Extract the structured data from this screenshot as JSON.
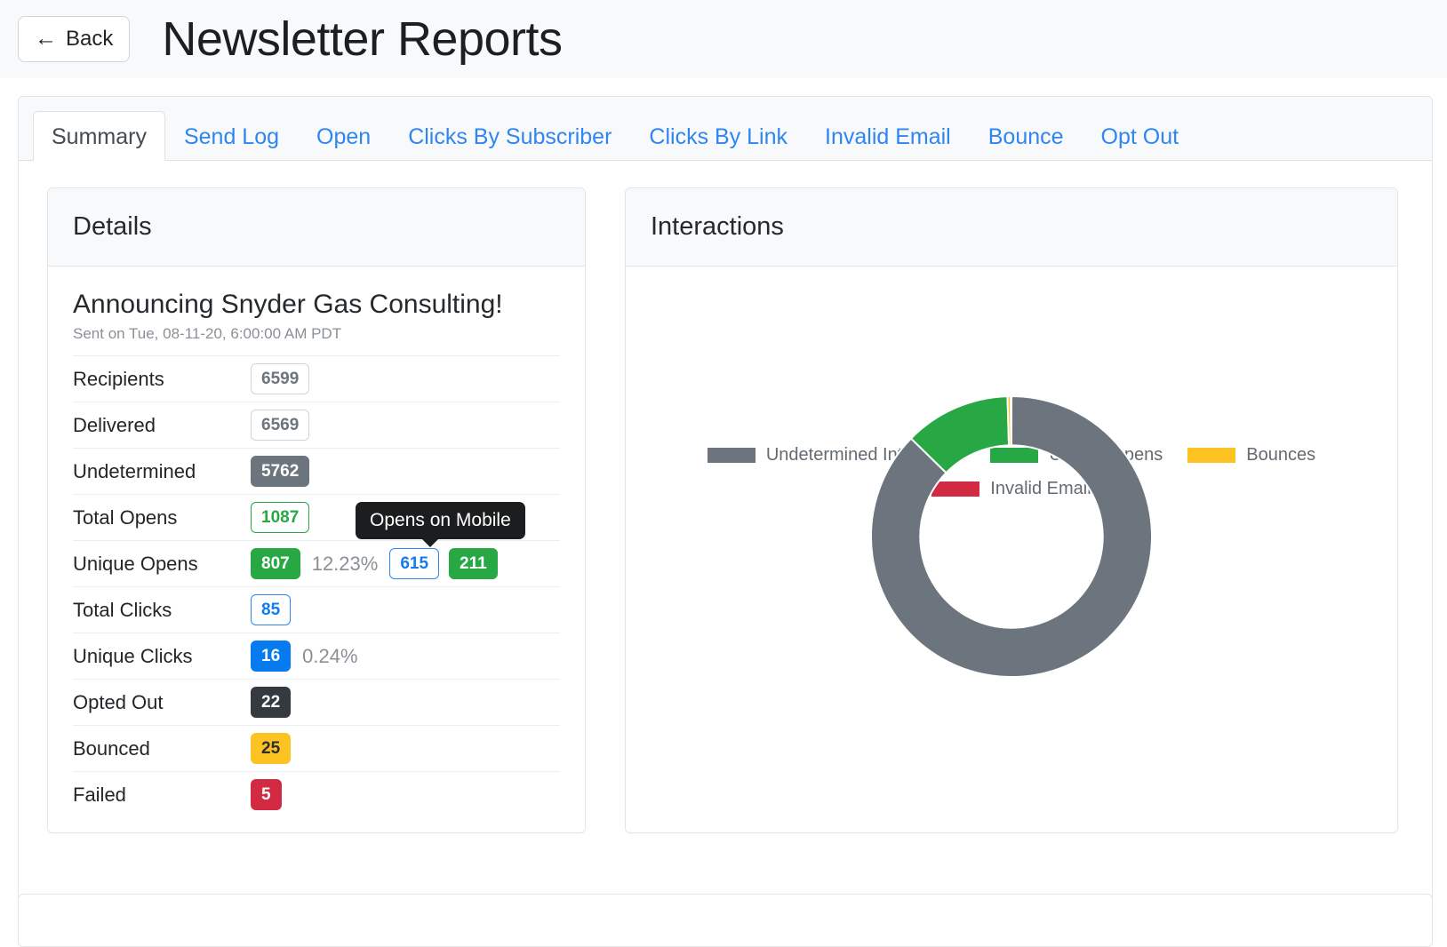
{
  "header": {
    "back_label": "Back",
    "back_icon": "arrow-left-icon",
    "title": "Newsletter Reports"
  },
  "tabs": [
    {
      "label": "Summary",
      "active": true
    },
    {
      "label": "Send Log",
      "active": false
    },
    {
      "label": "Open",
      "active": false
    },
    {
      "label": "Clicks By Subscriber",
      "active": false
    },
    {
      "label": "Clicks By Link",
      "active": false
    },
    {
      "label": "Invalid Email",
      "active": false
    },
    {
      "label": "Bounce",
      "active": false
    },
    {
      "label": "Opt Out",
      "active": false
    }
  ],
  "details": {
    "panel_title": "Details",
    "campaign_title": "Announcing Snyder Gas Consulting!",
    "sent_on": "Sent on Tue, 08-11-20, 6:00:00 AM PDT",
    "metrics": [
      {
        "label": "Recipients",
        "value": "6599",
        "style": "outline-secondary"
      },
      {
        "label": "Delivered",
        "value": "6569",
        "style": "outline-secondary"
      },
      {
        "label": "Undetermined",
        "value": "5762",
        "style": "solid-secondary"
      },
      {
        "label": "Total Opens",
        "value": "1087",
        "style": "outline-success"
      },
      {
        "label": "Unique Opens",
        "value": "807",
        "style": "solid-success",
        "percent": "12.23%",
        "extra": [
          {
            "value": "615",
            "style": "outline-primary"
          },
          {
            "value": "211",
            "style": "solid-success"
          }
        ],
        "tooltip": "Opens on Mobile"
      },
      {
        "label": "Total Clicks",
        "value": "85",
        "style": "outline-primary"
      },
      {
        "label": "Unique Clicks",
        "value": "16",
        "style": "solid-primary",
        "percent": "0.24%"
      },
      {
        "label": "Opted Out",
        "value": "22",
        "style": "solid-dark"
      },
      {
        "label": "Bounced",
        "value": "25",
        "style": "solid-warning"
      },
      {
        "label": "Failed",
        "value": "5",
        "style": "solid-danger"
      }
    ]
  },
  "interactions": {
    "panel_title": "Interactions"
  },
  "chart_data": {
    "type": "pie",
    "variant": "donut",
    "title": "Interactions",
    "legend_position": "top",
    "labels": [
      "Undetermined Interaction",
      "Unique Opens",
      "Bounces",
      "Invalid Email"
    ],
    "values": [
      5762,
      807,
      25,
      5
    ],
    "colors": [
      "#6c757d",
      "#28a745",
      "#fdc323",
      "#d32a44"
    ],
    "percentages": [
      87.3,
      12.2,
      0.38,
      0.08
    ],
    "center_hole_ratio": 0.65,
    "start_angle_deg": 0
  },
  "colors": {
    "accent_blue": "#2f86f0",
    "success_green": "#28a745",
    "warning_yellow": "#fdc323",
    "danger_red": "#d32a44",
    "secondary_gray": "#6c757d",
    "dark": "#343a40",
    "panel_bg": "#f8f9fa"
  }
}
